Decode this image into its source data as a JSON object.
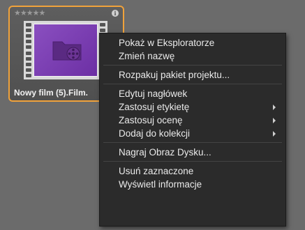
{
  "tile": {
    "rating_stars": "★★★★★",
    "label": "Nowy film (5).Film.",
    "info_icon_glyph": "i",
    "icons": {
      "stars": "star-rating-icon",
      "info": "info-icon",
      "thumbnail": "film-project-folder-icon"
    }
  },
  "menu": {
    "groups": [
      [
        {
          "label": "Pokaż w Eksploratorze",
          "submenu": false
        },
        {
          "label": "Zmień nazwę",
          "submenu": false
        }
      ],
      [
        {
          "label": "Rozpakuj pakiet projektu...",
          "submenu": false
        }
      ],
      [
        {
          "label": "Edytuj nagłówek",
          "submenu": false
        },
        {
          "label": "Zastosuj etykietę",
          "submenu": true
        },
        {
          "label": "Zastosuj ocenę",
          "submenu": true
        },
        {
          "label": "Dodaj do kolekcji",
          "submenu": true
        }
      ],
      [
        {
          "label": "Nagraj Obraz Dysku...",
          "submenu": false
        }
      ],
      [
        {
          "label": "Usuń zaznaczone",
          "submenu": false
        },
        {
          "label": "Wyświetl informacje",
          "submenu": false
        }
      ]
    ]
  },
  "colors": {
    "background": "#6b6b6b",
    "selection_border": "#f0a23b",
    "menu_bg": "#2b2b2b",
    "thumbnail_purple": "#7a3db5"
  }
}
